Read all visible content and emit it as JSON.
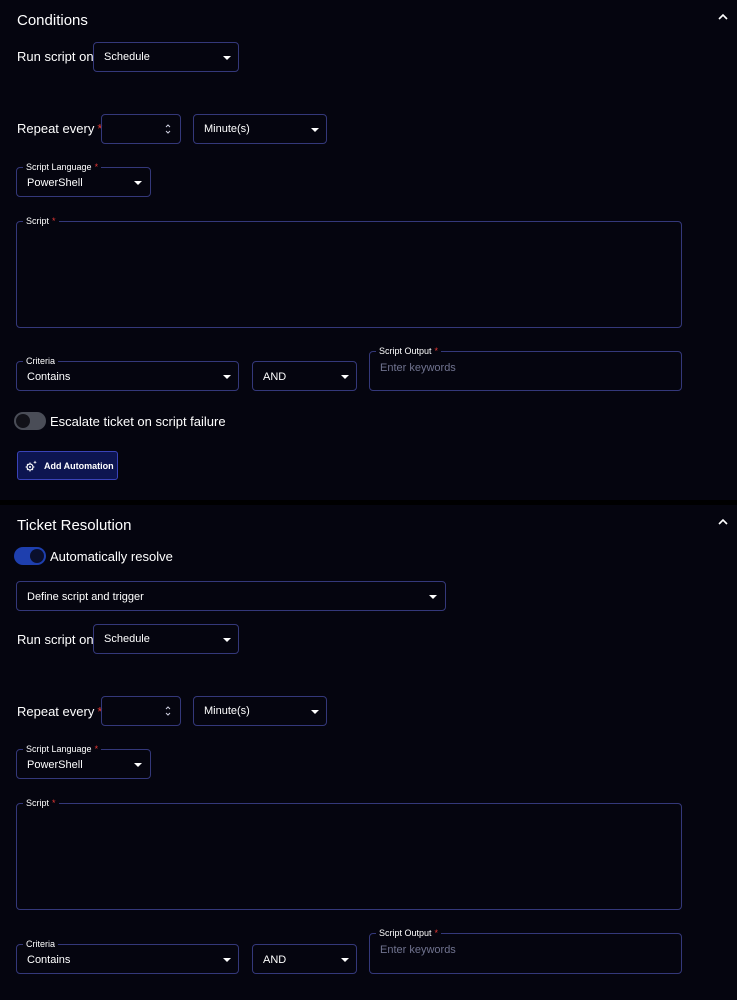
{
  "conditions": {
    "title": "Conditions",
    "run_script_on_label": "Run script on",
    "run_script_on_value": "Schedule",
    "repeat_every_label": "Repeat every",
    "repeat_every_value": "",
    "repeat_unit_value": "Minute(s)",
    "script_language_label": "Script Language",
    "script_language_value": "PowerShell",
    "script_label": "Script",
    "criteria_label": "Criteria",
    "criteria_value": "Contains",
    "operator_value": "AND",
    "script_output_label": "Script Output",
    "script_output_placeholder": "Enter keywords",
    "escalate_label": "Escalate ticket on script failure",
    "escalate_on": false,
    "add_automation_label": "Add Automation"
  },
  "ticket_resolution": {
    "title": "Ticket Resolution",
    "auto_resolve_label": "Automatically resolve",
    "auto_resolve_on": true,
    "mode_value": "Define script and trigger",
    "run_script_on_label": "Run script on",
    "run_script_on_value": "Schedule",
    "repeat_every_label": "Repeat every",
    "repeat_every_value": "",
    "repeat_unit_value": "Minute(s)",
    "script_language_label": "Script Language",
    "script_language_value": "PowerShell",
    "script_label": "Script",
    "criteria_label": "Criteria",
    "criteria_value": "Contains",
    "operator_value": "AND",
    "script_output_label": "Script Output",
    "script_output_placeholder": "Enter keywords"
  },
  "required_marker": "*",
  "icons": {
    "collapse": "chevron-up-icon",
    "dropdown": "caret-down-icon",
    "stepper": "stepper-icon",
    "automation": "gear-sparkle-icon"
  },
  "colors": {
    "background": "#05050f",
    "border": "#34387a",
    "accent": "#1e3fae",
    "required": "#e53935",
    "button_bg": "#0d1550"
  }
}
